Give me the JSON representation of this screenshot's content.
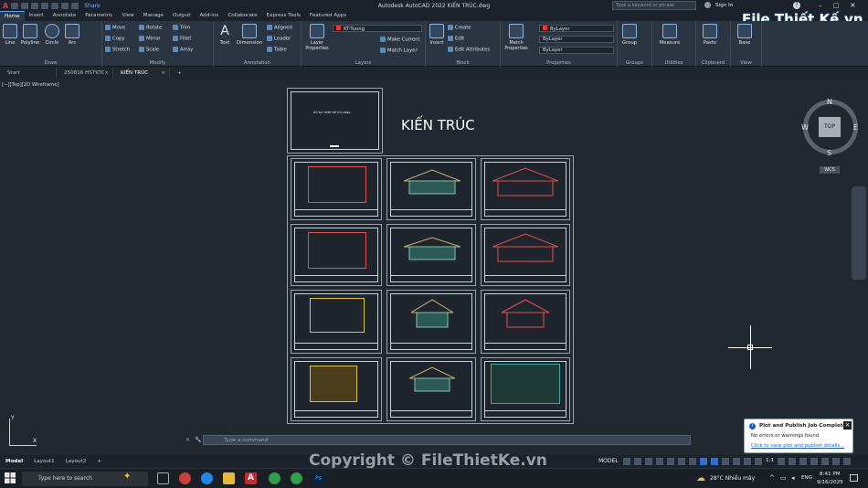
{
  "window": {
    "title": "Autodesk AutoCAD 2022    KIẾN TRÚC.dwg",
    "share_label": "Share",
    "search_placeholder": "Type a keyword or phrase",
    "signin_label": "Sign In"
  },
  "ribbon_tabs": [
    "Home",
    "Insert",
    "Annotate",
    "Parametric",
    "View",
    "Manage",
    "Output",
    "Add-ins",
    "Collaborate",
    "Express Tools",
    "Featured Apps"
  ],
  "panels": {
    "draw": {
      "title": "Draw",
      "line": "Line",
      "polyline": "Polyline",
      "circle": "Circle",
      "arc": "Arc"
    },
    "modify": {
      "title": "Modify",
      "move": "Move",
      "copy": "Copy",
      "stretch": "Stretch",
      "rotate": "Rotate",
      "mirror": "Mirror",
      "scale": "Scale",
      "trim": "Trim",
      "fillet": "Fillet",
      "array": "Array"
    },
    "annotation": {
      "title": "Annotation",
      "text": "Text",
      "dimension": "Dimension",
      "aligned": "Aligned",
      "leader": "Leader",
      "table": "Table"
    },
    "layers": {
      "title": "Layers",
      "properties": "Layer Properties",
      "current_layer": "KT-Tuong",
      "make_current": "Make Current",
      "match_layer": "Match Layer"
    },
    "block": {
      "title": "Block",
      "insert": "Insert",
      "create": "Create",
      "edit": "Edit",
      "edit_attributes": "Edit Attributes"
    },
    "properties": {
      "title": "Properties",
      "match": "Match Properties",
      "color": "ByLayer",
      "linetype": "ByLayer",
      "lineweight": "ByLayer"
    },
    "groups": {
      "title": "Groups",
      "group": "Group"
    },
    "utilities": {
      "title": "Utilities",
      "measure": "Measure"
    },
    "clipboard": {
      "title": "Clipboard",
      "paste": "Paste"
    },
    "view": {
      "title": "View",
      "base": "Base"
    }
  },
  "logo_text": "File Thiết Kế.vn",
  "doc_tabs": [
    {
      "label": "Start"
    },
    {
      "label": "250816 HSTKTC"
    },
    {
      "label": "KIẾN TRÚC",
      "active": true
    }
  ],
  "viewport": {
    "label": "[−][Top][2D Wireframe]",
    "drawing_title": "KIẾN TRÚC",
    "cover_text": "HỒ SƠ THIẾT KẾ THI CÔNG"
  },
  "viewcube": {
    "top": "TOP",
    "n": "N",
    "s": "S",
    "e": "E",
    "w": "W",
    "wcs": "WCS"
  },
  "command": {
    "placeholder": "Type a command"
  },
  "layout_tabs": [
    "Model",
    "Layout1",
    "Layout2"
  ],
  "status": {
    "model": "MODEL",
    "scale": "1:1"
  },
  "notification": {
    "title": "Plot and Publish Job Complete",
    "body": "No errors or warnings found",
    "link": "Click to view plot and publish details..."
  },
  "watermark": "Copyright © FileThietKe.vn",
  "taskbar": {
    "search": "Type here to search",
    "weather": "28°C  Nhiều mây",
    "lang": "ENG",
    "time": "8:41 PM",
    "date": "9/16/2025"
  }
}
